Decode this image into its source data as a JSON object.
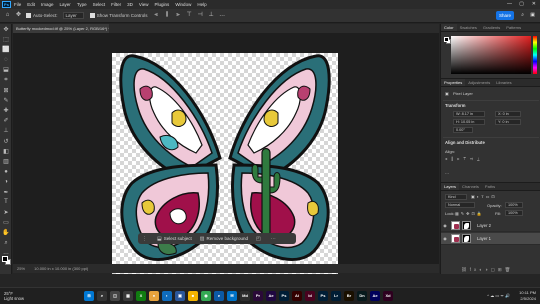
{
  "menu": {
    "logo": "Ps",
    "items": [
      "File",
      "Edit",
      "Image",
      "Layer",
      "Type",
      "Select",
      "Filter",
      "3D",
      "View",
      "Plugins",
      "Window",
      "Help"
    ]
  },
  "options": {
    "auto_select_label": "Auto-Select:",
    "auto_select_value": "Layer",
    "show_transform_label": "Show Transform Controls",
    "share_label": "Share"
  },
  "document": {
    "tab_title": "Butterfly mockedmod.tif @ 25% (Layer 2, RGB/16*) *",
    "status_zoom": "25%",
    "status_info": "10.000 in x 10.000 in (300 ppi)"
  },
  "context_bar": {
    "select_subject": "Select subject",
    "remove_background": "Remove background"
  },
  "panels": {
    "color_tabs": [
      "Color",
      "Swatches",
      "Gradients",
      "Patterns"
    ],
    "props_tabs": [
      "Properties",
      "Adjustments",
      "Libraries"
    ],
    "props_type": "Pixel Layer",
    "transform_label": "Transform",
    "w_value": "W: 8.17 in",
    "h_value": "H: 10.05 in",
    "x_value": "X: 0 in",
    "y_value": "Y: 0 in",
    "angle_value": "0.00°",
    "align_label": "Align and Distribute",
    "align_sub": "Align:",
    "layers_tabs": [
      "Layers",
      "Channels",
      "Paths"
    ],
    "kind_label": "Kind",
    "blend_mode": "Normal",
    "opacity_label": "Opacity:",
    "opacity_value": "100%",
    "lock_label": "Lock:",
    "fill_label": "Fill:",
    "fill_value": "100%",
    "layers": [
      {
        "name": "Layer 2",
        "selected": false
      },
      {
        "name": "Layer 1",
        "selected": true
      }
    ]
  },
  "taskbar": {
    "weather_temp": "25°F",
    "weather_desc": "Light snow",
    "apps": [
      {
        "label": "⊞",
        "color": "#0078d4"
      },
      {
        "label": "⌕",
        "color": "#333333"
      },
      {
        "label": "◫",
        "color": "#444444"
      },
      {
        "label": "▦",
        "color": "#3a3a3a"
      },
      {
        "label": "X",
        "color": "#107c10"
      },
      {
        "label": "●",
        "color": "#e8a33d"
      },
      {
        "label": "◐",
        "color": "#0f6cbd"
      },
      {
        "label": "▣",
        "color": "#2b579a"
      },
      {
        "label": "■",
        "color": "#f4b400"
      },
      {
        "label": "◉",
        "color": "#34a853"
      },
      {
        "label": "e",
        "color": "#0c59a4"
      },
      {
        "label": "✉",
        "color": "#0072c6"
      },
      {
        "label": "Md",
        "color": "#2d2d2d"
      },
      {
        "label": "Pr",
        "color": "#2a0a38"
      },
      {
        "label": "Ae",
        "color": "#1f0740"
      },
      {
        "label": "Ps",
        "color": "#001e36"
      },
      {
        "label": "Ai",
        "color": "#330000"
      },
      {
        "label": "Id",
        "color": "#49021f"
      },
      {
        "label": "Ps",
        "color": "#001e36"
      },
      {
        "label": "Lr",
        "color": "#001d34"
      },
      {
        "label": "Br",
        "color": "#1a1000"
      },
      {
        "label": "Dn",
        "color": "#071a1c"
      },
      {
        "label": "Ae",
        "color": "#00005b"
      },
      {
        "label": "Xd",
        "color": "#2e001f"
      }
    ],
    "time": "10:11 PM",
    "date": "2/5/2024"
  }
}
